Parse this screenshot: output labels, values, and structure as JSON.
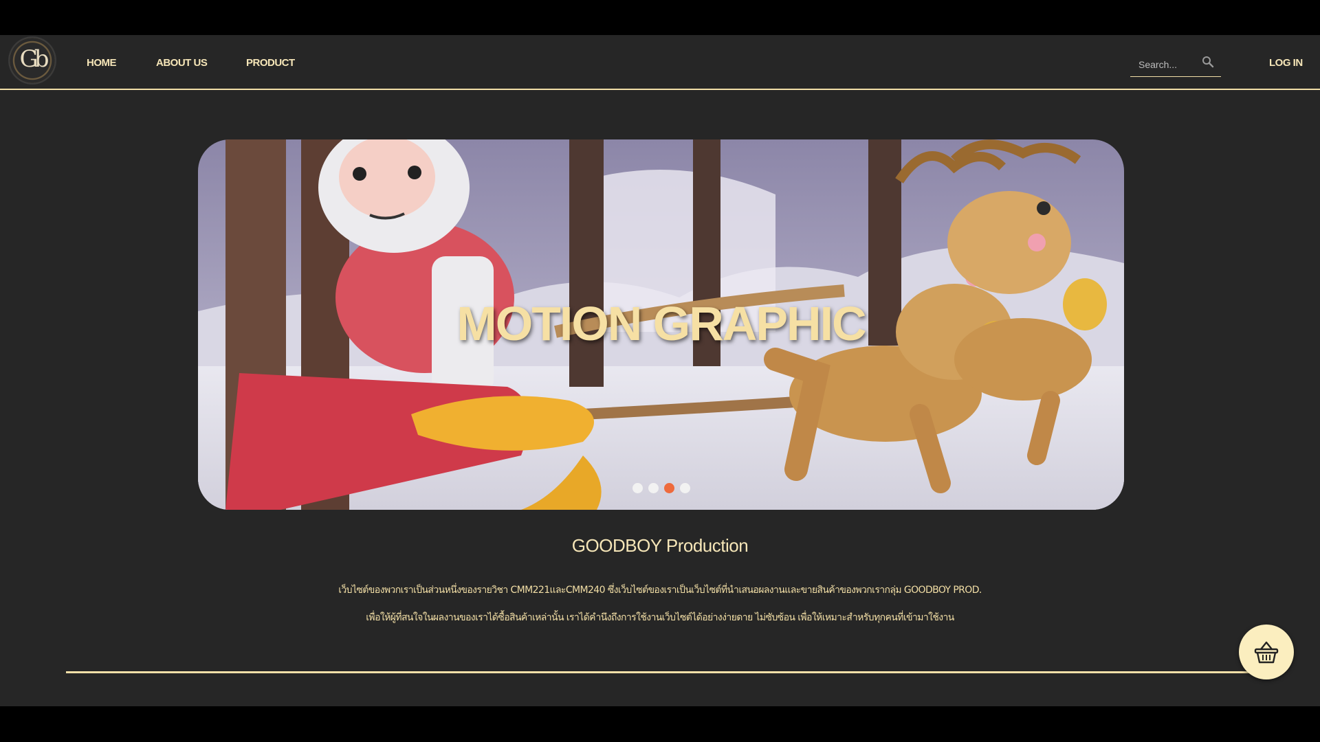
{
  "nav": {
    "logo_text": "Gb",
    "links": [
      "HOME",
      "ABOUT US",
      "PRODUCT"
    ],
    "search_placeholder": "Search...",
    "login_label": "LOG IN"
  },
  "hero": {
    "title": "MOTION GRAPHIC",
    "slide_count": 4,
    "active_slide": 3
  },
  "about": {
    "title": "GOODBOY Production",
    "line1": "เว็บไซต์ของพวกเราเป็นส่วนหนึ่งของรายวิชา CMM221และCMM240 ซึ่งเว็บไซต์ของเราเป็นเว็บไซต์ที่นำเสนอผลงานและขายสินค้าของพวกเรากลุ่ม GOODBOY PROD.",
    "line2": "เพื่อให้ผู้ที่สนใจในผลงานของเราได้ซื้อสินค้าเหล่านั้น เราได้คำนึงถึงการใช้งานเว็บไซต์ได้อย่างง่ายดาย ไม่ซับซ้อน เพื่อให้เหมาะสำหรับทุกคนที่เข้ามาใช้งาน"
  },
  "icons": {
    "search": "search-icon",
    "cart": "basket-icon"
  },
  "colors": {
    "accent": "#f3e0a8",
    "background": "#262626",
    "active_dot": "#ee6a3c"
  }
}
